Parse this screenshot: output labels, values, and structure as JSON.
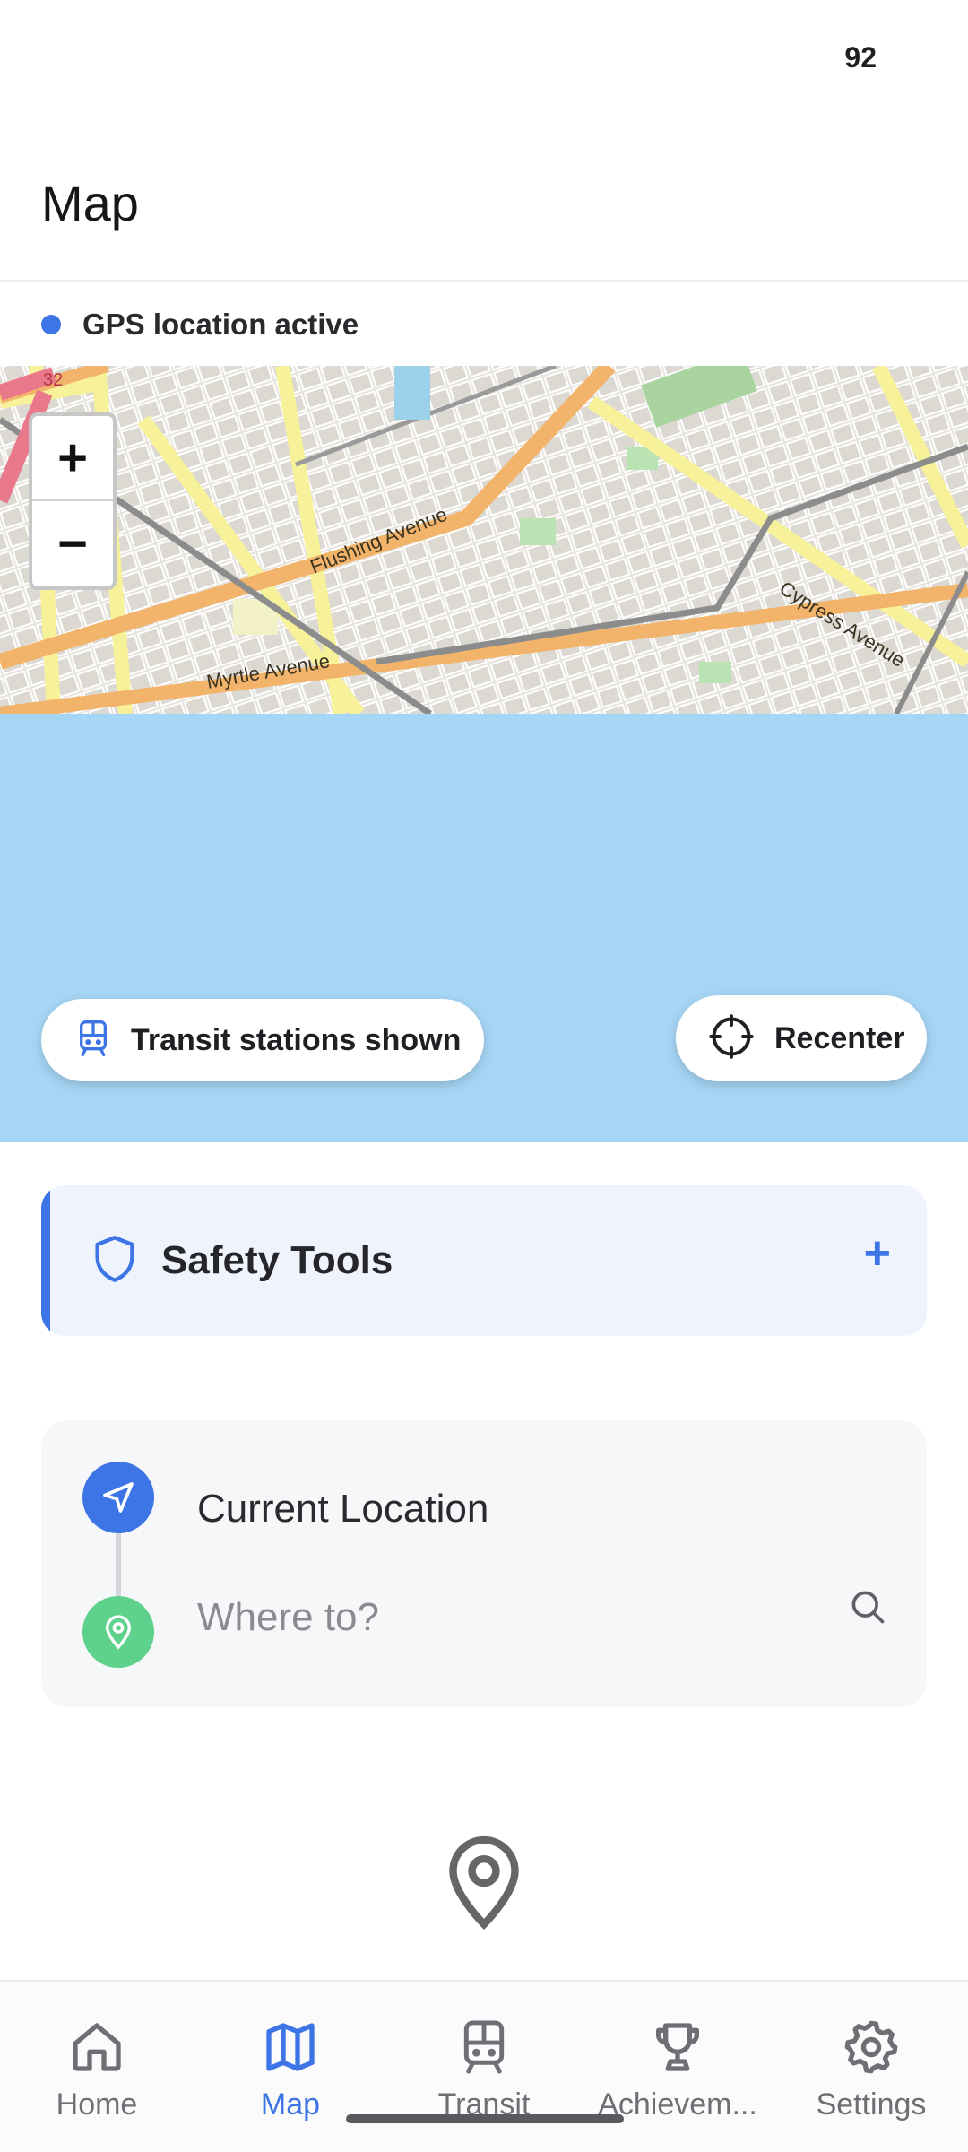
{
  "status_bar": {
    "battery": "92"
  },
  "header": {
    "title": "Map"
  },
  "gps_banner": {
    "text": "GPS location active",
    "dot_color": "#3d74e6"
  },
  "map": {
    "street_labels": [
      "Flushing Avenue",
      "Myrtle Avenue",
      "Cypress Avenue",
      "32"
    ],
    "zoom_in_label": "+",
    "zoom_out_label": "−"
  },
  "chips": {
    "transit": {
      "label": "Transit stations shown",
      "icon": "train-icon"
    },
    "recenter": {
      "label": "Recenter",
      "icon": "crosshair-icon"
    }
  },
  "safety_tools": {
    "title": "Safety Tools",
    "icon": "shield-icon",
    "expand_label": "+",
    "accent_color": "#3d74e6"
  },
  "route": {
    "origin": "Current Location",
    "destination_placeholder": "Where to?",
    "origin_icon": "navigation-arrow-icon",
    "destination_icon": "map-pin-icon"
  },
  "nav": {
    "items": [
      {
        "label": "Home",
        "icon": "home-icon",
        "active": false
      },
      {
        "label": "Map",
        "icon": "map-icon",
        "active": true
      },
      {
        "label": "Transit",
        "icon": "train-icon",
        "active": false
      },
      {
        "label": "Achievem...",
        "icon": "trophy-icon",
        "active": false
      },
      {
        "label": "Settings",
        "icon": "gear-icon",
        "active": false
      }
    ]
  },
  "colors": {
    "accent": "#3d74e6",
    "water": "#a6d6f5",
    "destination": "#5ed18d"
  }
}
